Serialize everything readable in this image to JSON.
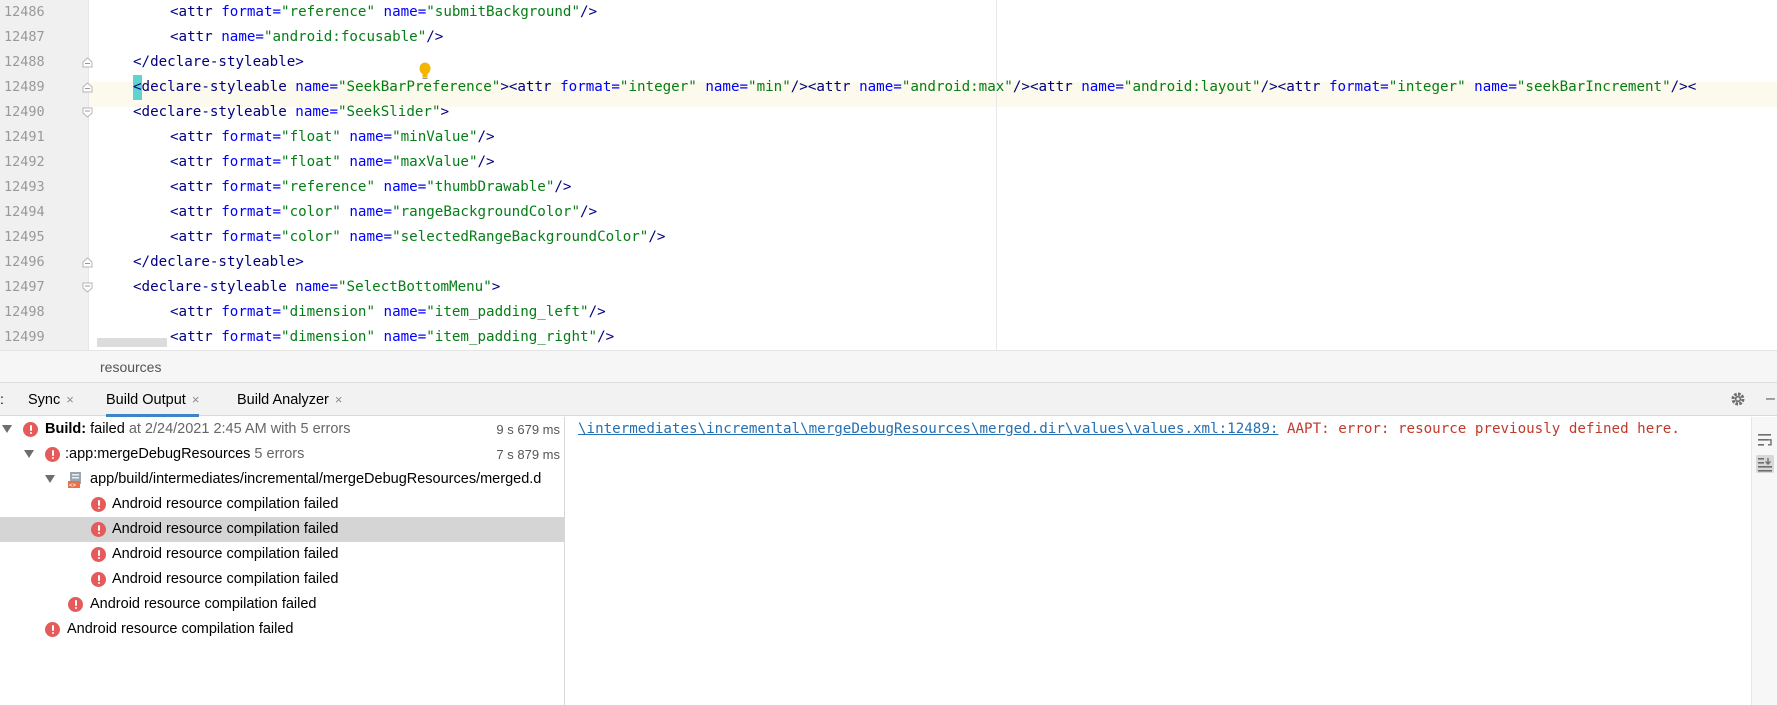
{
  "editor": {
    "lines": [
      {
        "n": "12486",
        "indent": 2,
        "segments": [
          [
            "tag",
            "<attr "
          ],
          [
            "attr",
            "format="
          ],
          [
            "val",
            "\"reference\""
          ],
          [
            "attr",
            " name="
          ],
          [
            "val",
            "\"submitBackground\""
          ],
          [
            "tag",
            "/>"
          ]
        ]
      },
      {
        "n": "12487",
        "indent": 2,
        "segments": [
          [
            "tag",
            "<attr "
          ],
          [
            "attr",
            "name="
          ],
          [
            "val",
            "\"android:focusable\""
          ],
          [
            "tag",
            "/>"
          ]
        ]
      },
      {
        "n": "12488",
        "indent": 1,
        "segments": [
          [
            "tag",
            "</declare-styleable>"
          ]
        ]
      },
      {
        "n": "12489",
        "indent": 1,
        "cursor": true,
        "segments": [
          [
            "tag",
            "declare-styleable "
          ],
          [
            "attr",
            "name="
          ],
          [
            "val",
            "\"SeekBarPreference\""
          ],
          [
            "tag",
            "><attr "
          ],
          [
            "attr",
            "format="
          ],
          [
            "val",
            "\"integer\""
          ],
          [
            "attr",
            " name="
          ],
          [
            "val",
            "\"min\""
          ],
          [
            "tag",
            "/><attr "
          ],
          [
            "attr",
            "name="
          ],
          [
            "val",
            "\"android:max\""
          ],
          [
            "tag",
            "/><attr "
          ],
          [
            "attr",
            "name="
          ],
          [
            "val",
            "\"android:layout\""
          ],
          [
            "tag",
            "/><attr "
          ],
          [
            "attr",
            "format="
          ],
          [
            "val",
            "\"integer\""
          ],
          [
            "attr",
            " name="
          ],
          [
            "val",
            "\"seekBarIncrement\""
          ],
          [
            "tag",
            "/><"
          ]
        ]
      },
      {
        "n": "12490",
        "indent": 1,
        "segments": [
          [
            "tag",
            "<declare-styleable "
          ],
          [
            "attr",
            "name="
          ],
          [
            "val",
            "\"SeekSlider\""
          ],
          [
            "tag",
            ">"
          ]
        ]
      },
      {
        "n": "12491",
        "indent": 2,
        "segments": [
          [
            "tag",
            "<attr "
          ],
          [
            "attr",
            "format="
          ],
          [
            "val",
            "\"float\""
          ],
          [
            "attr",
            " name="
          ],
          [
            "val",
            "\"minValue\""
          ],
          [
            "tag",
            "/>"
          ]
        ]
      },
      {
        "n": "12492",
        "indent": 2,
        "segments": [
          [
            "tag",
            "<attr "
          ],
          [
            "attr",
            "format="
          ],
          [
            "val",
            "\"float\""
          ],
          [
            "attr",
            " name="
          ],
          [
            "val",
            "\"maxValue\""
          ],
          [
            "tag",
            "/>"
          ]
        ]
      },
      {
        "n": "12493",
        "indent": 2,
        "segments": [
          [
            "tag",
            "<attr "
          ],
          [
            "attr",
            "format="
          ],
          [
            "val",
            "\"reference\""
          ],
          [
            "attr",
            " name="
          ],
          [
            "val",
            "\"thumbDrawable\""
          ],
          [
            "tag",
            "/>"
          ]
        ]
      },
      {
        "n": "12494",
        "indent": 2,
        "segments": [
          [
            "tag",
            "<attr "
          ],
          [
            "attr",
            "format="
          ],
          [
            "val",
            "\"color\""
          ],
          [
            "attr",
            " name="
          ],
          [
            "val",
            "\"rangeBackgroundColor\""
          ],
          [
            "tag",
            "/>"
          ]
        ]
      },
      {
        "n": "12495",
        "indent": 2,
        "segments": [
          [
            "tag",
            "<attr "
          ],
          [
            "attr",
            "format="
          ],
          [
            "val",
            "\"color\""
          ],
          [
            "attr",
            " name="
          ],
          [
            "val",
            "\"selectedRangeBackgroundColor\""
          ],
          [
            "tag",
            "/>"
          ]
        ]
      },
      {
        "n": "12496",
        "indent": 1,
        "segments": [
          [
            "tag",
            "</declare-styleable>"
          ]
        ]
      },
      {
        "n": "12497",
        "indent": 1,
        "segments": [
          [
            "tag",
            "<declare-styleable "
          ],
          [
            "attr",
            "name="
          ],
          [
            "val",
            "\"SelectBottomMenu\""
          ],
          [
            "tag",
            ">"
          ]
        ]
      },
      {
        "n": "12498",
        "indent": 2,
        "segments": [
          [
            "tag",
            "<attr "
          ],
          [
            "attr",
            "format="
          ],
          [
            "val",
            "\"dimension\""
          ],
          [
            "attr",
            " name="
          ],
          [
            "val",
            "\"item_padding_left\""
          ],
          [
            "tag",
            "/>"
          ]
        ]
      },
      {
        "n": "12499",
        "indent": 2,
        "segments": [
          [
            "tag",
            "<attr "
          ],
          [
            "attr",
            "format="
          ],
          [
            "val",
            "\"dimension\""
          ],
          [
            "attr",
            " name="
          ],
          [
            "val",
            "\"item_padding_right\""
          ],
          [
            "tag",
            "/>"
          ]
        ]
      }
    ],
    "cursor_char": "<"
  },
  "breadcrumb": {
    "text": "resources"
  },
  "tool_window": {
    "prefix": ":",
    "tabs": [
      {
        "label": "Sync",
        "close": "×"
      },
      {
        "label": "Build Output",
        "close": "×",
        "active": true
      },
      {
        "label": "Build Analyzer",
        "close": "×"
      }
    ]
  },
  "build_tree": {
    "root": {
      "label": "Build:",
      "status": "failed",
      "detail": "at 2/24/2021 2:45 AM with 5 errors",
      "time": "9 s 679 ms"
    },
    "task": {
      "label": ":app:mergeDebugResources",
      "detail": "5 errors",
      "time": "7 s 879 ms"
    },
    "file": {
      "label": "app/build/intermediates/incremental/mergeDebugResources/merged.d"
    },
    "errors": [
      "Android resource compilation failed",
      "Android resource compilation failed",
      "Android resource compilation failed",
      "Android resource compilation failed",
      "Android resource compilation failed",
      "Android resource compilation failed"
    ]
  },
  "console": {
    "link": "\\intermediates\\incremental\\mergeDebugResources\\merged.dir\\values\\values.xml:12489:",
    "message": " AAPT: error: resource previously defined here."
  },
  "colors": {
    "tag": "#000080",
    "attribute": "#0000ff",
    "value": "#067d17",
    "error": "#e55b5b",
    "link": "#2470b3"
  }
}
